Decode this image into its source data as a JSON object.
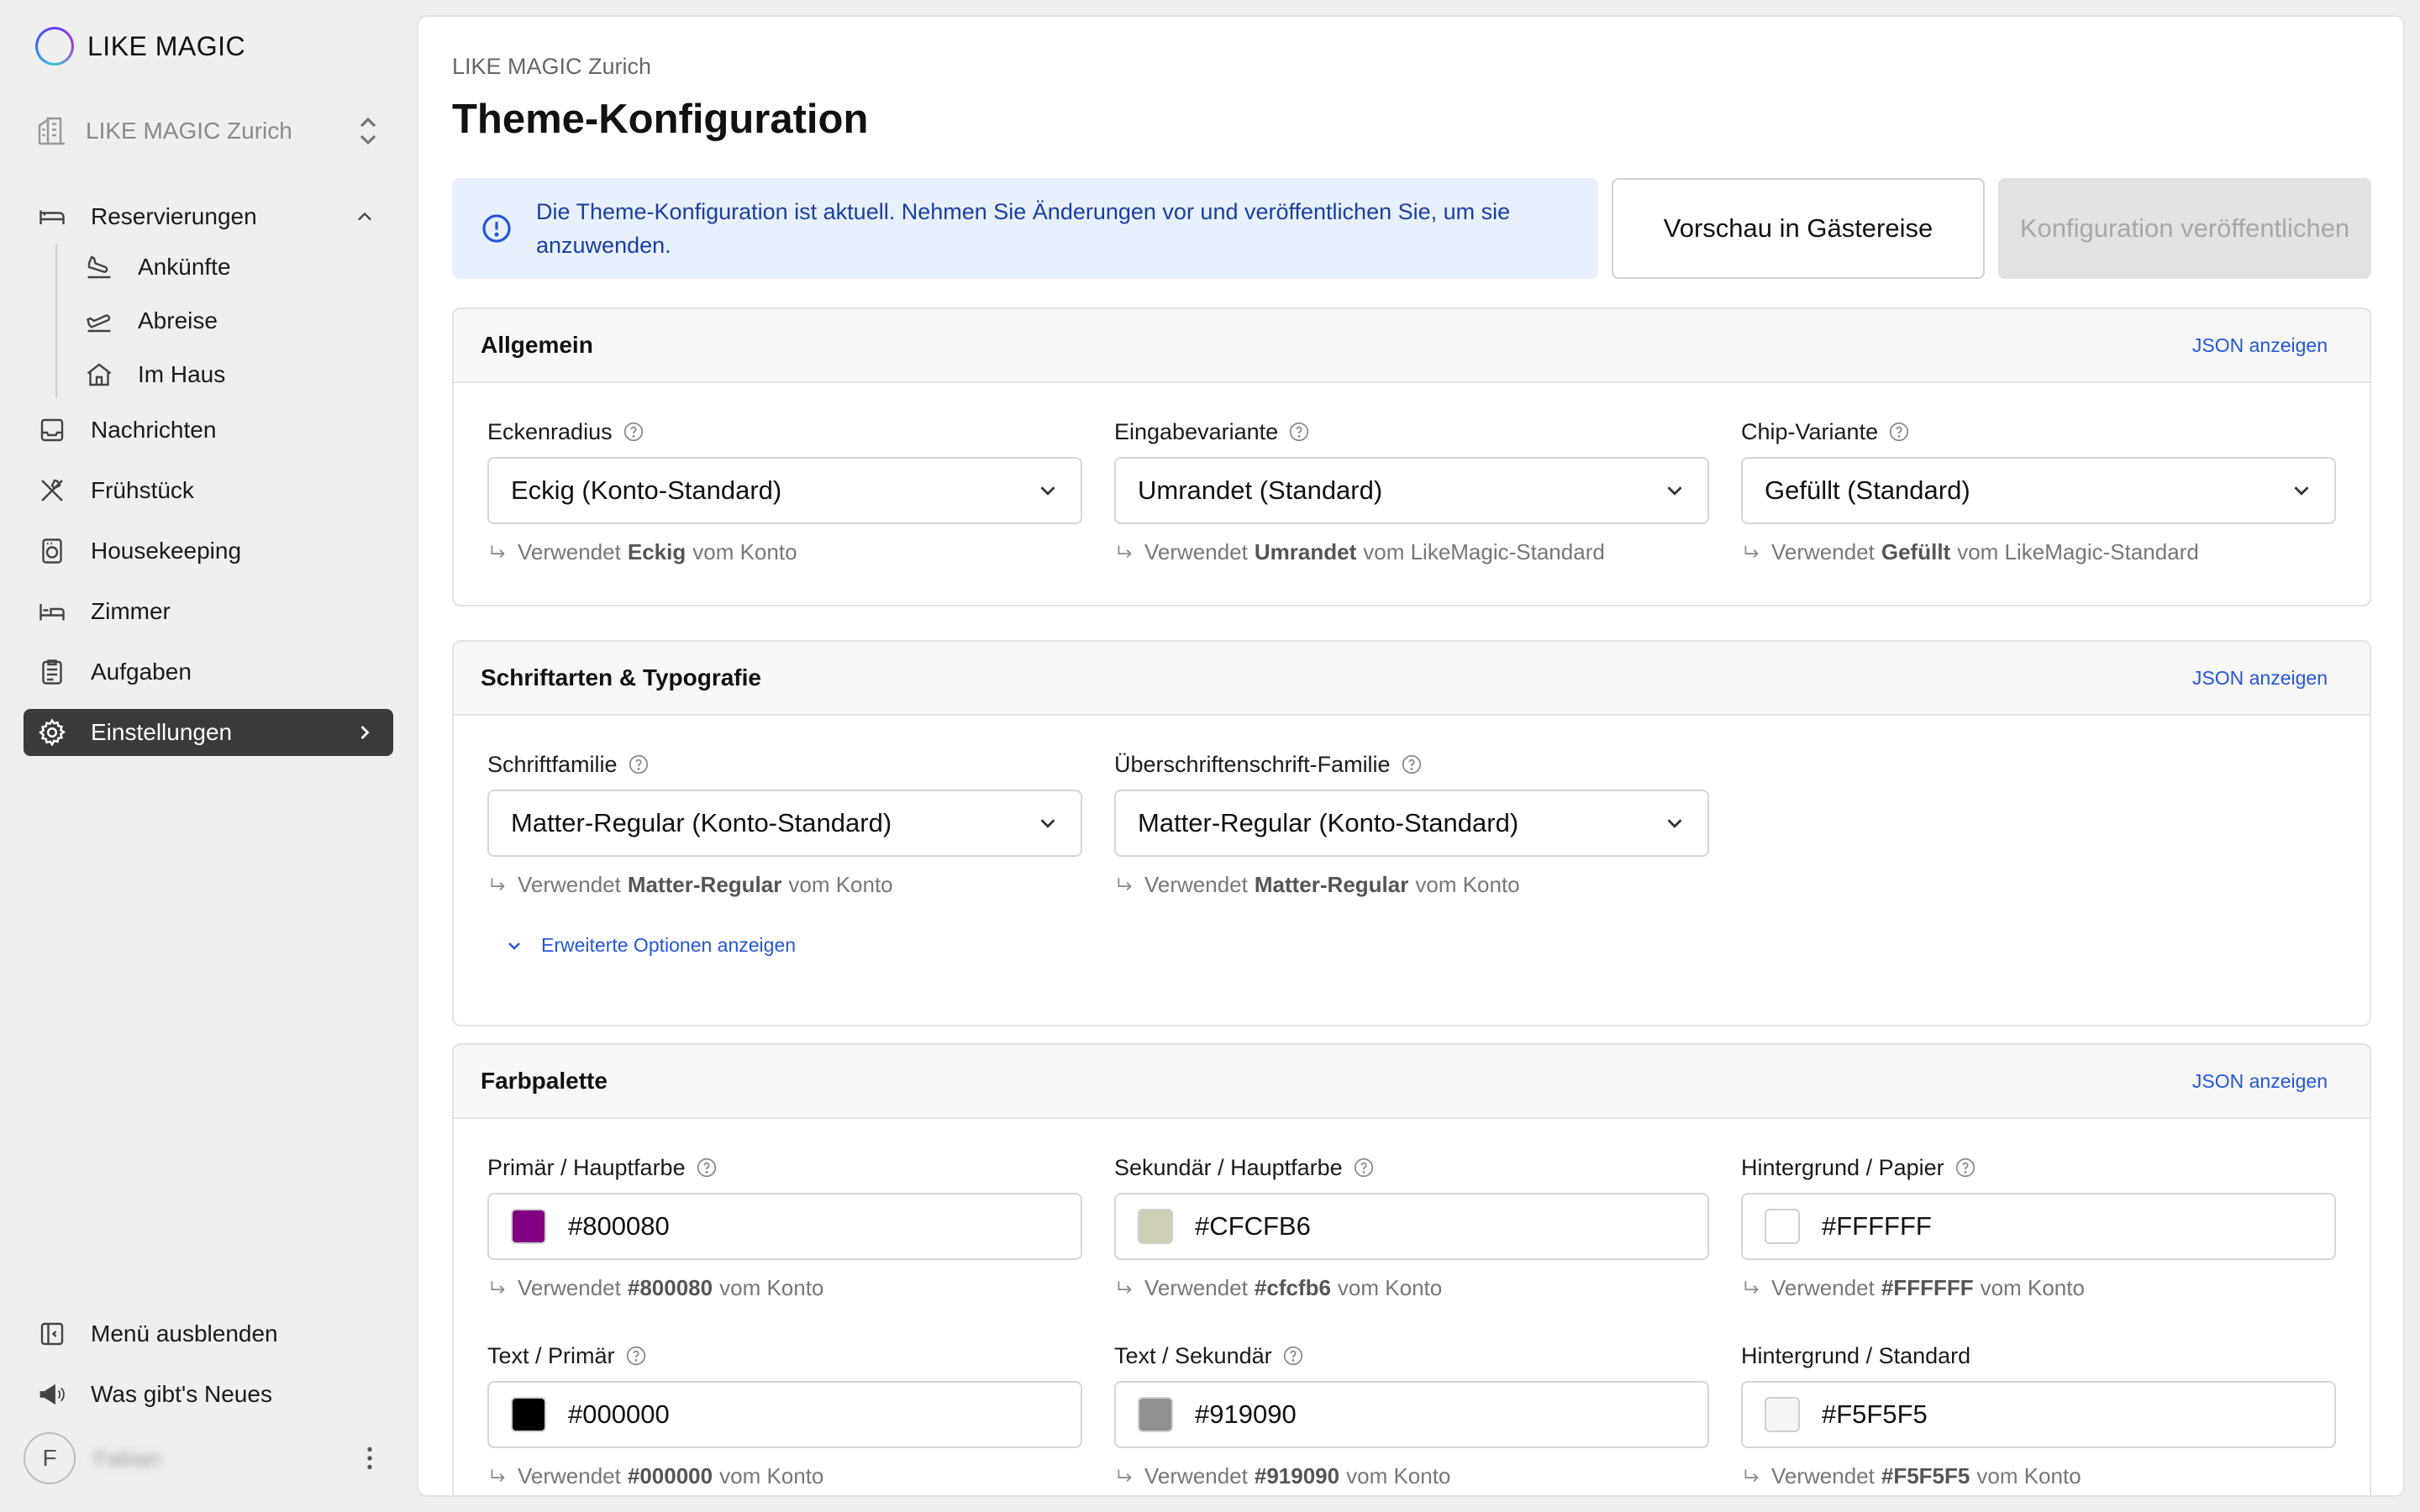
{
  "sidebar": {
    "brand": "LIKE MAGIC",
    "hotel": "LIKE MAGIC Zurich",
    "items": {
      "reservations": "Reservierungen",
      "arrivals": "Ankünfte",
      "departures": "Abreise",
      "in_house": "Im Haus",
      "messages": "Nachrichten",
      "breakfast": "Frühstück",
      "housekeeping": "Housekeeping",
      "rooms": "Zimmer",
      "tasks": "Aufgaben",
      "settings": "Einstellungen"
    },
    "bottom": {
      "hide_menu": "Menü ausblenden",
      "whats_new": "Was gibt's Neues"
    },
    "user": {
      "initial": "F",
      "name": "Fabian"
    }
  },
  "header": {
    "breadcrumb": "LIKE MAGIC Zurich",
    "title": "Theme-Konfiguration",
    "alert": "Die Theme-Konfiguration ist aktuell. Nehmen Sie Änderungen vor und veröffentlichen Sie, um sie anzuwenden.",
    "preview_button": "Vorschau in Gästereise",
    "publish_button": "Konfiguration veröffentlichen"
  },
  "common": {
    "json_link": "JSON anzeigen",
    "uses": "Verwendet",
    "from_account": "vom Konto",
    "from_default": "vom LikeMagic-Standard"
  },
  "general": {
    "title": "Allgemein",
    "corner_radius": {
      "label": "Eckenradius",
      "value": "Eckig (Konto-Standard)",
      "source": "Eckig"
    },
    "input_variant": {
      "label": "Eingabevariante",
      "value": "Umrandet (Standard)",
      "source": "Umrandet"
    },
    "chip_variant": {
      "label": "Chip-Variante",
      "value": "Gefüllt (Standard)",
      "source": "Gefüllt"
    }
  },
  "fonts": {
    "title": "Schriftarten & Typografie",
    "family": {
      "label": "Schriftfamilie",
      "value": "Matter-Regular (Konto-Standard)",
      "source": "Matter-Regular"
    },
    "heading_family": {
      "label": "Überschriftenschrift-Familie",
      "value": "Matter-Regular (Konto-Standard)",
      "source": "Matter-Regular"
    },
    "advanced": "Erweiterte Optionen anzeigen"
  },
  "palette": {
    "title": "Farbpalette",
    "primary_main": {
      "label": "Primär / Hauptfarbe",
      "value": "#800080",
      "source": "#800080",
      "swatch": "#800080"
    },
    "secondary_main": {
      "label": "Sekundär / Hauptfarbe",
      "value": "#CFCFB6",
      "source": "#cfcfb6",
      "swatch": "#CFCFB6"
    },
    "background_paper": {
      "label": "Hintergrund / Papier",
      "value": "#FFFFFF",
      "source": "#FFFFFF",
      "swatch": "#FFFFFF"
    },
    "text_primary": {
      "label": "Text / Primär",
      "value": "#000000",
      "source": "#000000",
      "swatch": "#000000"
    },
    "text_secondary": {
      "label": "Text / Sekundär",
      "value": "#919090",
      "source": "#919090",
      "swatch": "#919090"
    },
    "background_default": {
      "label": "Hintergrund / Standard",
      "value": "#F5F5F5",
      "source": "#F5F5F5",
      "swatch": "#F5F5F5"
    }
  }
}
